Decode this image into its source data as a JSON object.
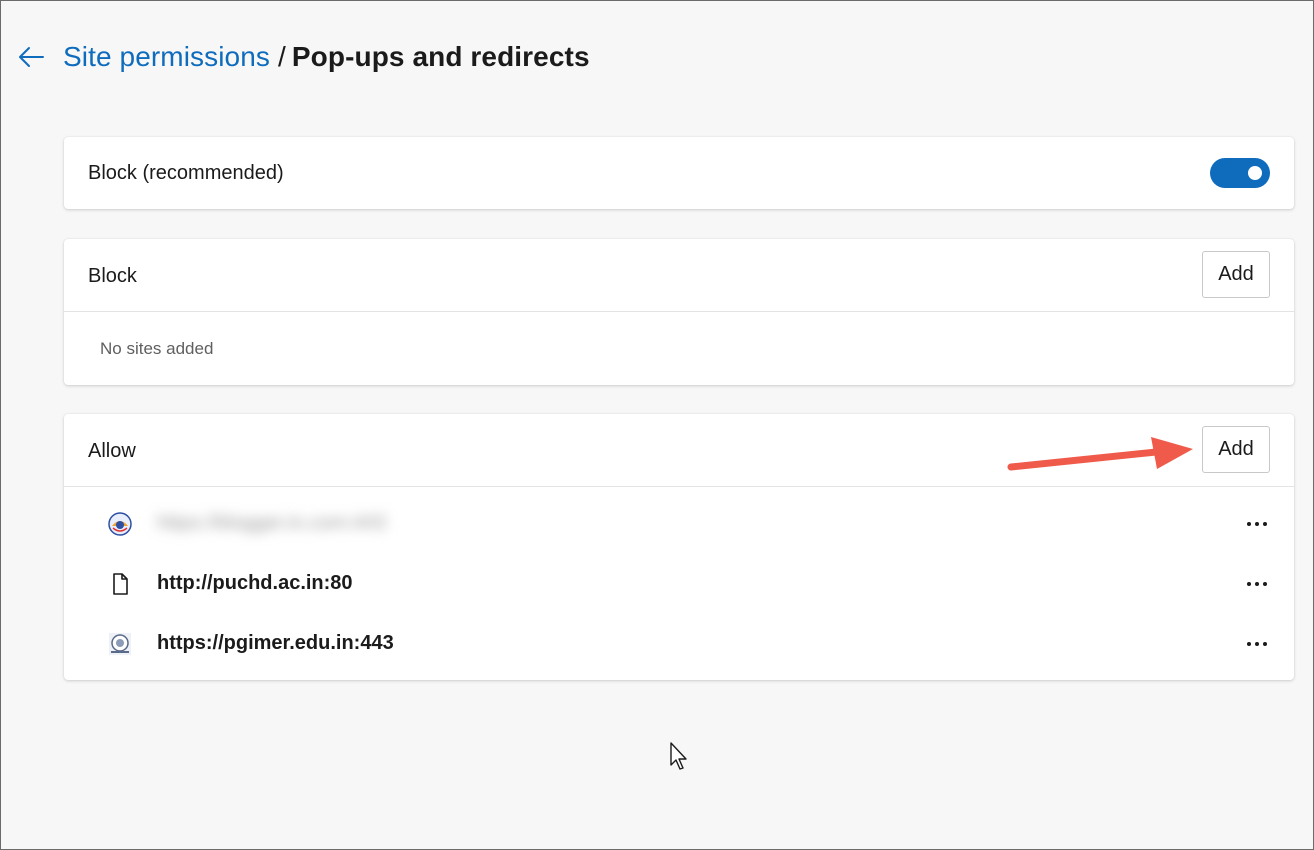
{
  "header": {
    "back_icon": "back-arrow-icon",
    "breadcrumb_parent": "Site permissions",
    "separator": "/",
    "breadcrumb_current": "Pop-ups and redirects"
  },
  "recommended": {
    "label": "Block (recommended)",
    "toggle_on": true
  },
  "block_section": {
    "title": "Block",
    "add_label": "Add",
    "empty_text": "No sites added"
  },
  "allow_section": {
    "title": "Allow",
    "add_label": "Add",
    "sites": [
      {
        "url": "https://blogger.in.com:443",
        "icon": "site-favicon-icon",
        "blurred": true
      },
      {
        "url": "http://puchd.ac.in:80",
        "icon": "document-icon",
        "blurred": false
      },
      {
        "url": "https://pgimer.edu.in:443",
        "icon": "site-favicon-icon",
        "blurred": false
      }
    ]
  },
  "colors": {
    "accent": "#0f6cbd",
    "annotation_arrow": "#f05a4a",
    "background": "#f7f7f7"
  }
}
